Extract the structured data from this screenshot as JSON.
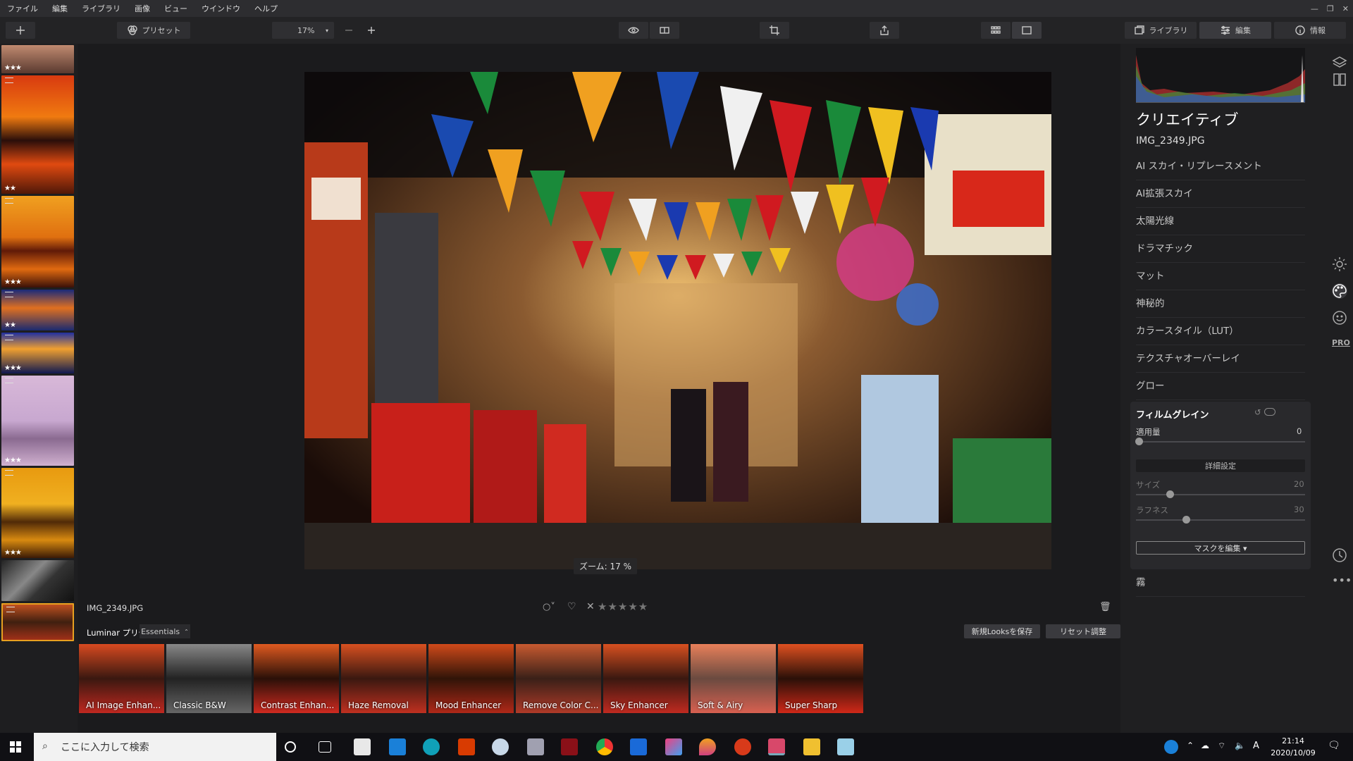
{
  "menubar": {
    "items": [
      "ファイル",
      "編集",
      "ライブラリ",
      "画像",
      "ビュー",
      "ウインドウ",
      "ヘルプ"
    ]
  },
  "toolbar": {
    "preset_label": "プリセット",
    "zoom_value": "17%",
    "tabs": [
      {
        "label": "ライブラリ",
        "icon": "library-icon"
      },
      {
        "label": "編集",
        "icon": "sliders-icon"
      },
      {
        "label": "情報",
        "icon": "info-icon"
      }
    ]
  },
  "filmstrip": {
    "thumbs": [
      {
        "stars": "★★★",
        "adjusted": false
      },
      {
        "stars": "★★",
        "adjusted": true
      },
      {
        "stars": "★★★",
        "adjusted": true
      },
      {
        "stars": "★★",
        "adjusted": true
      },
      {
        "stars": "★★★",
        "adjusted": true
      },
      {
        "stars": "★★★",
        "adjusted": true
      },
      {
        "stars": "★★★",
        "adjusted": true
      },
      {
        "stars": "",
        "adjusted": false
      },
      {
        "stars": "",
        "adjusted": true
      }
    ]
  },
  "canvas": {
    "zoom_label": "ズーム: 17 %"
  },
  "infobar": {
    "filename": "IMG_2349.JPG",
    "rating_stars": "★★★★★"
  },
  "presets": {
    "section_label": "Luminar プリセット",
    "collection": "Essentials",
    "save_button": "新規Looksを保存",
    "reset_button": "リセット調整",
    "items": [
      "AI Image Enhan...",
      "Classic B&W",
      "Contrast Enhan...",
      "Haze Removal",
      "Mood Enhancer",
      "Remove Color C...",
      "Sky Enhancer",
      "Soft & Airy",
      "Super Sharp"
    ]
  },
  "rpanel": {
    "title": "クリエイティブ",
    "file": "IMG_2349.JPG",
    "tools": [
      "AI スカイ・リプレースメント",
      "AI拡張スカイ",
      "太陽光線",
      "ドラマチック",
      "マット",
      "神秘的",
      "カラースタイル（LUT）",
      "テクスチャオーバーレイ",
      "グロー"
    ],
    "film_grain": {
      "title": "フィルムグレイン",
      "amount_label": "適用量",
      "amount_value": "0",
      "advanced_label": "詳細設定",
      "size_label": "サイズ",
      "size_value": "20",
      "roughness_label": "ラフネス",
      "roughness_value": "30",
      "mask_button": "マスクを編集 ▾"
    },
    "fog": "霧"
  },
  "rail": {
    "icons": [
      "layers-icon",
      "canvas-icon",
      "sun-icon",
      "palette-icon",
      "face-icon",
      "pro-label",
      "history-icon",
      "more-icon"
    ],
    "pro_label": "PRO"
  },
  "taskbar": {
    "search_placeholder": "ここに入力して検索",
    "time": "21:14",
    "date": "2020/10/09",
    "ime": "A"
  }
}
